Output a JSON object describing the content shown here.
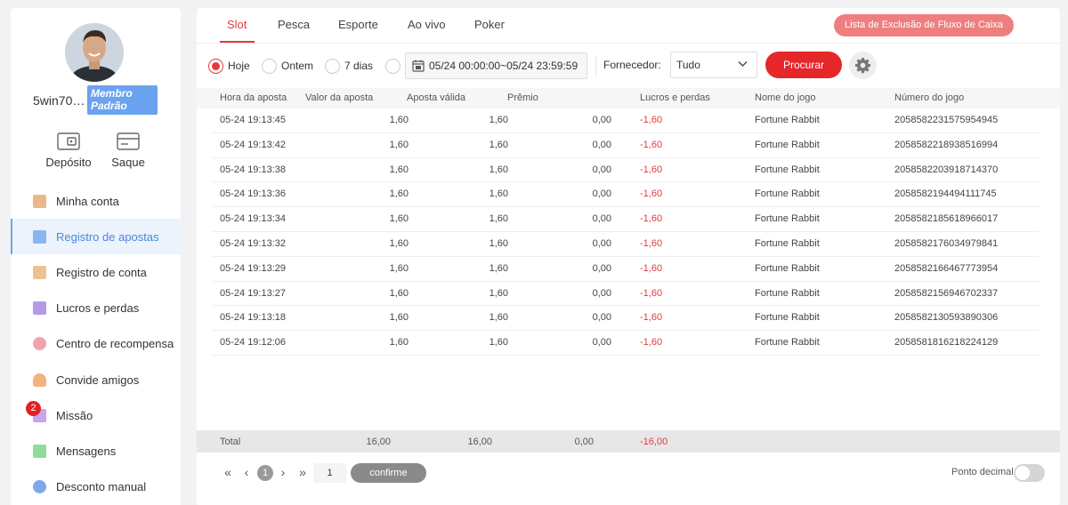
{
  "sidebar": {
    "username": "5win70…",
    "badge": "Membro Padrão",
    "deposit_label": "Depósito",
    "withdraw_label": "Saque",
    "items": [
      {
        "label": "Minha conta",
        "icon": "coins-icon",
        "color": "#e9b98b"
      },
      {
        "label": "Registro de apostas",
        "icon": "bet-record-icon",
        "color": "#8ab6ee"
      },
      {
        "label": "Registro de conta",
        "icon": "account-record-icon",
        "color": "#eec193"
      },
      {
        "label": "Lucros e perdas",
        "icon": "profit-loss-icon",
        "color": "#b59ae8"
      },
      {
        "label": "Centro de recompensa",
        "icon": "reward-icon",
        "color": "#f3a3b0"
      },
      {
        "label": "Convide amigos",
        "icon": "invite-icon",
        "color": "#f0b47c"
      },
      {
        "label": "Missão",
        "icon": "mission-icon",
        "color": "#c7a6ec"
      },
      {
        "label": "Mensagens",
        "icon": "message-icon",
        "color": "#8fdc9a"
      },
      {
        "label": "Desconto manual",
        "icon": "discount-icon",
        "color": "#7ea8ea"
      }
    ],
    "mission_badge": "2"
  },
  "tabs": [
    "Slot",
    "Pesca",
    "Esporte",
    "Ao vivo",
    "Poker"
  ],
  "exclusion_button": "Lista de Exclusão de Fluxo de Caixa",
  "filters": {
    "radio_today": "Hoje",
    "radio_yesterday": "Ontem",
    "radio_7days": "7 dias",
    "date_range": "05/24 00:00:00~05/24 23:59:59",
    "provider_label": "Fornecedor:",
    "provider_value": "Tudo",
    "search_button": "Procurar"
  },
  "table": {
    "headers": [
      "Hora da aposta",
      "Valor da aposta",
      "Aposta válida",
      "Prêmio",
      "Lucros e perdas",
      "Nome do jogo",
      "Número do jogo"
    ],
    "rows": [
      [
        "05-24 19:13:45",
        "1,60",
        "1,60",
        "0,00",
        "-1,60",
        "Fortune Rabbit",
        "2058582231575954945"
      ],
      [
        "05-24 19:13:42",
        "1,60",
        "1,60",
        "0,00",
        "-1,60",
        "Fortune Rabbit",
        "2058582218938516994"
      ],
      [
        "05-24 19:13:38",
        "1,60",
        "1,60",
        "0,00",
        "-1,60",
        "Fortune Rabbit",
        "2058582203918714370"
      ],
      [
        "05-24 19:13:36",
        "1,60",
        "1,60",
        "0,00",
        "-1,60",
        "Fortune Rabbit",
        "2058582194494111745"
      ],
      [
        "05-24 19:13:34",
        "1,60",
        "1,60",
        "0,00",
        "-1,60",
        "Fortune Rabbit",
        "2058582185618966017"
      ],
      [
        "05-24 19:13:32",
        "1,60",
        "1,60",
        "0,00",
        "-1,60",
        "Fortune Rabbit",
        "2058582176034979841"
      ],
      [
        "05-24 19:13:29",
        "1,60",
        "1,60",
        "0,00",
        "-1,60",
        "Fortune Rabbit",
        "2058582166467773954"
      ],
      [
        "05-24 19:13:27",
        "1,60",
        "1,60",
        "0,00",
        "-1,60",
        "Fortune Rabbit",
        "2058582156946702337"
      ],
      [
        "05-24 19:13:18",
        "1,60",
        "1,60",
        "0,00",
        "-1,60",
        "Fortune Rabbit",
        "2058582130593890306"
      ],
      [
        "05-24 19:12:06",
        "1,60",
        "1,60",
        "0,00",
        "-1,60",
        "Fortune Rabbit",
        "2058581816218224129"
      ]
    ],
    "total": {
      "label": "Total",
      "valor": "16,00",
      "valida": "16,00",
      "premio": "0,00",
      "lucro": "-16,00"
    }
  },
  "pager": {
    "current_page": "1",
    "page_input": "1",
    "confirm": "confirme",
    "decimal_label": "Ponto decimal"
  },
  "colors": {
    "accent": "#e4393c",
    "link_blue": "#4a86d8",
    "badge_blue": "#6aa3ef"
  }
}
